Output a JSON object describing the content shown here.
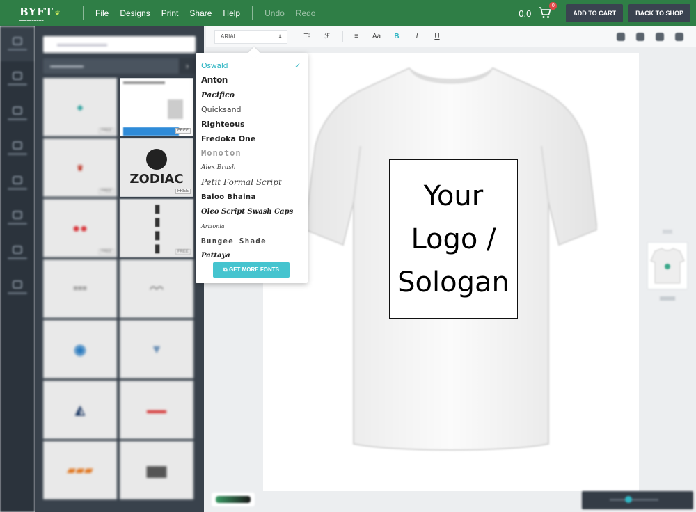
{
  "header": {
    "logo": "BYFT",
    "menu": [
      "File",
      "Designs",
      "Print",
      "Share",
      "Help"
    ],
    "undo": "Undo",
    "redo": "Redo",
    "price": "0.0",
    "cart_count": "0",
    "add_to_cart": "ADD TO CART",
    "back_to_shop": "BACK TO SHOP"
  },
  "toolbar": {
    "font_family": "ARIAL",
    "bold_label": "B",
    "italic_label": "I",
    "underline_label": "U",
    "case_label": "Aa"
  },
  "font_dropdown": {
    "selected": "Oswald",
    "fonts": [
      "Oswald",
      "Anton",
      "Pacifico",
      "Quicksand",
      "Righteous",
      "Fredoka One",
      "Monoton",
      "Alex Brush",
      "Petit Formal Script",
      "Baloo Bhaina",
      "Oleo Script Swash Caps",
      "Arizonia",
      "Bungee Shade",
      "Pattaya"
    ],
    "more_button": "GET MORE FONTS"
  },
  "templates": {
    "zodiac_title": "ZODIAC",
    "free_label": "FREE"
  },
  "canvas": {
    "design_text": "Your\nLogo /\nSologan"
  },
  "colors": {
    "topbar": "#2f7e46",
    "accent": "#45c4cf",
    "panel": "#39424c"
  }
}
